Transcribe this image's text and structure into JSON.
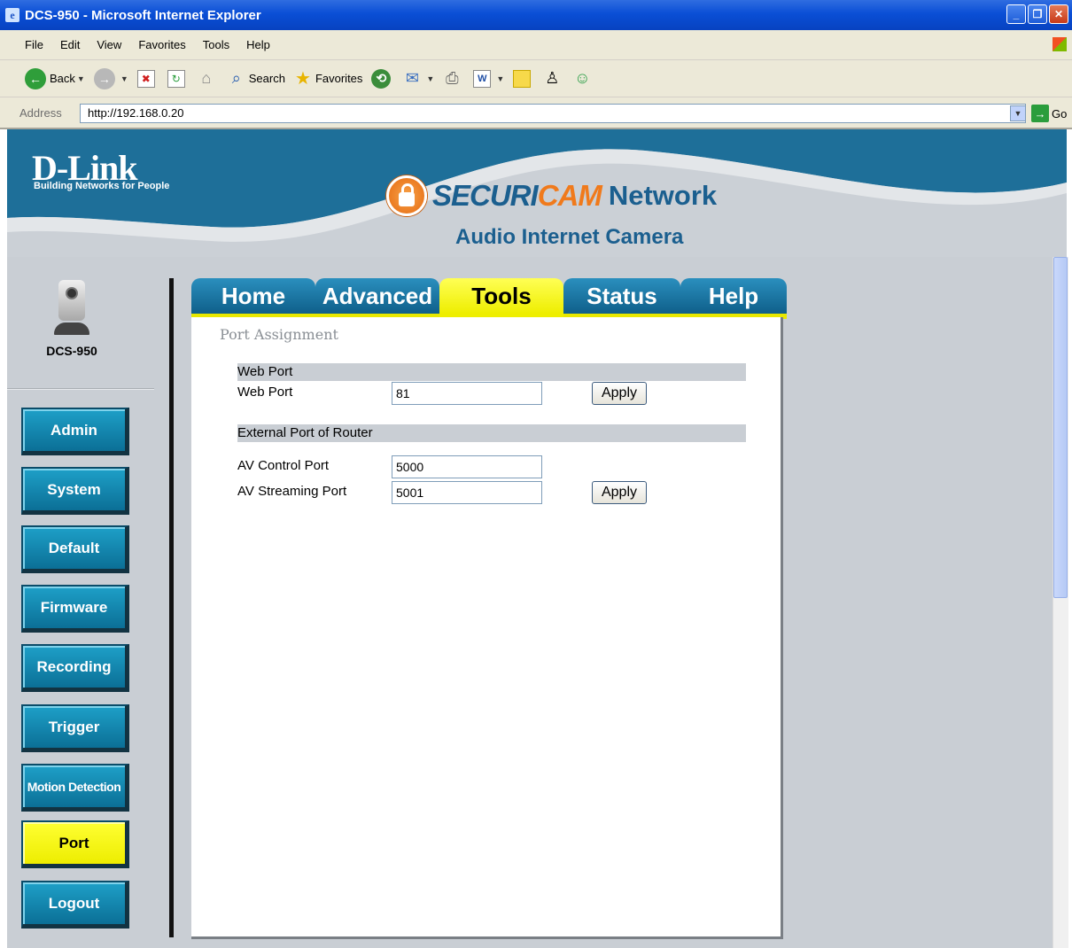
{
  "window": {
    "title": "DCS-950 - Microsoft Internet Explorer"
  },
  "menu": [
    "File",
    "Edit",
    "View",
    "Favorites",
    "Tools",
    "Help"
  ],
  "toolbar": {
    "back": "Back",
    "search": "Search",
    "favorites": "Favorites"
  },
  "address": {
    "label": "Address",
    "url": "http://192.168.0.20",
    "go": "Go"
  },
  "banner": {
    "logo": "D-Link",
    "tagline": "Building Networks for People",
    "product_brand_part1": "SECURI",
    "product_brand_part2": "CAM",
    "product_suffix": "Network",
    "subtitle": "Audio Internet Camera"
  },
  "camera": {
    "model": "DCS-950"
  },
  "tabs": [
    {
      "label": "Home",
      "active": false
    },
    {
      "label": "Advanced",
      "active": false
    },
    {
      "label": "Tools",
      "active": true
    },
    {
      "label": "Status",
      "active": false
    },
    {
      "label": "Help",
      "active": false
    }
  ],
  "nav": [
    {
      "label": "Admin",
      "active": false
    },
    {
      "label": "System",
      "active": false
    },
    {
      "label": "Default",
      "active": false
    },
    {
      "label": "Firmware",
      "active": false
    },
    {
      "label": "Recording",
      "active": false
    },
    {
      "label": "Trigger",
      "active": false
    },
    {
      "label": "Motion Detection",
      "active": false
    },
    {
      "label": "Port",
      "active": true
    },
    {
      "label": "Logout",
      "active": false
    }
  ],
  "panel": {
    "title": "Port Assignment",
    "web_port_section": "Web Port",
    "web_port_label": "Web Port",
    "web_port_value": "81",
    "apply_label": "Apply",
    "external_section": "External Port of Router",
    "av_control_label": "AV Control Port",
    "av_control_value": "5000",
    "av_streaming_label": "AV Streaming Port",
    "av_streaming_value": "5001"
  },
  "colors": {
    "accent_blue": "#1b5f8f",
    "accent_orange": "#f07a1c",
    "nav_teal": "#0b6f96",
    "active_yellow": "#eeee00"
  }
}
